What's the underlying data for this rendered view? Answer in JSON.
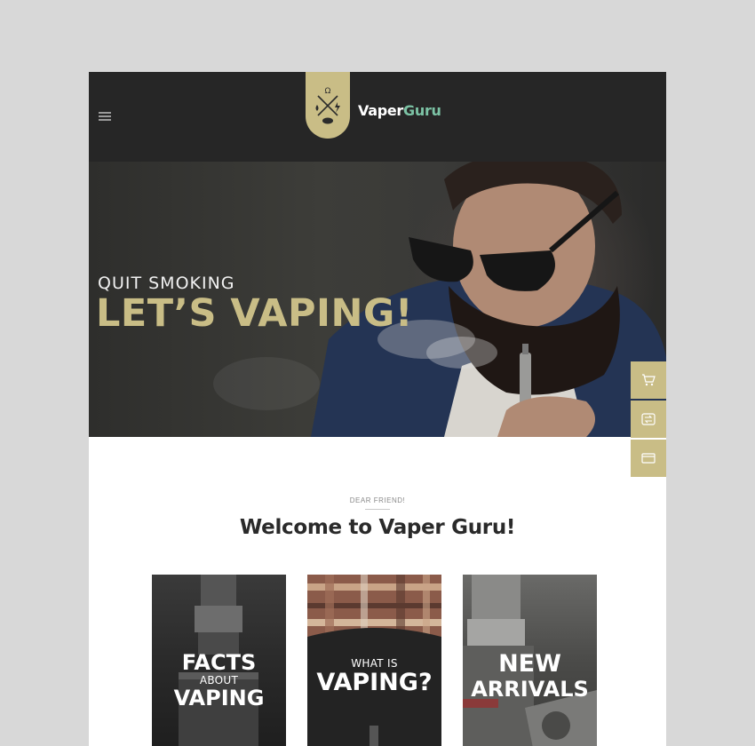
{
  "header": {
    "brand_part1": "Vaper",
    "brand_part2": "Guru"
  },
  "hero": {
    "subtitle": "QUIT SMOKING",
    "title": "LET’S VAPING!"
  },
  "welcome": {
    "eyebrow": "DEAR FRIEND!",
    "title": "Welcome to Vaper Guru!"
  },
  "cards": [
    {
      "line1": "FACTS",
      "line2": "ABOUT",
      "line3": "VAPING"
    },
    {
      "line1": "WHAT IS",
      "line2": "VAPING?"
    },
    {
      "line1": "NEW",
      "line2": "ARRIVALS"
    }
  ],
  "side_panel": {
    "icons": [
      "cart-icon",
      "exchange-icon",
      "card-icon"
    ]
  },
  "colors": {
    "accent": "#c9bd86",
    "brand_green": "#7cc3a5",
    "header_bg": "#262626"
  }
}
